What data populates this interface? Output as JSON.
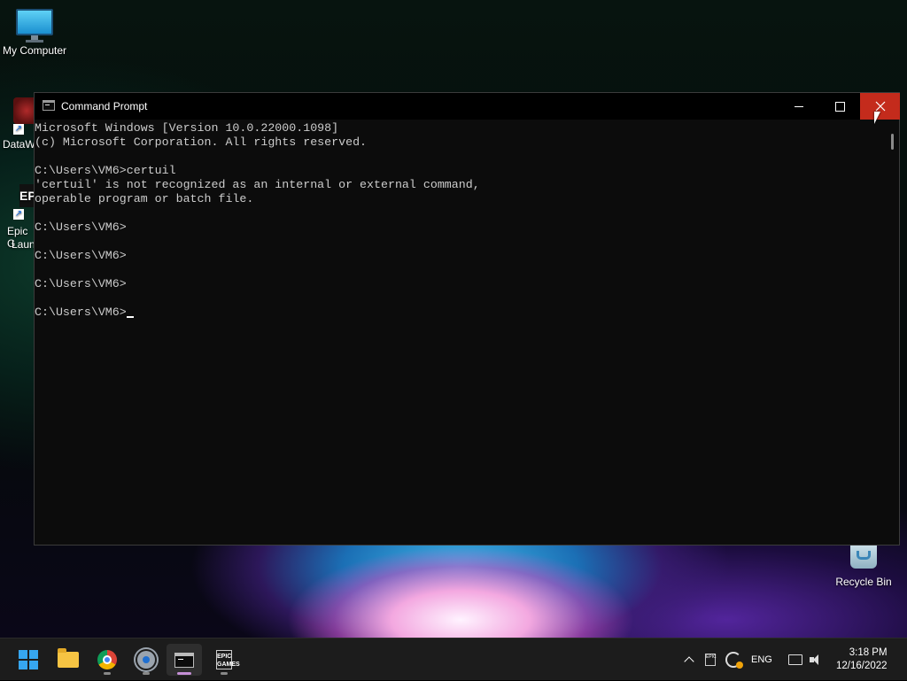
{
  "desktop": {
    "icons": {
      "my_computer": "My Computer",
      "datawrapper_partial": "DataW",
      "epic_partial_line1": "Epic G",
      "epic_partial_line2": "Laun",
      "recycle_bin": "Recycle Bin"
    }
  },
  "window": {
    "title": "Command Prompt",
    "icon": "cmd-icon",
    "controls": {
      "minimize": "minimize-icon",
      "maximize": "maximize-icon",
      "close": "close-icon"
    },
    "console_lines": [
      "Microsoft Windows [Version 10.0.22000.1098]",
      "(c) Microsoft Corporation. All rights reserved.",
      "",
      "C:\\Users\\VM6>certuil",
      "'certuil' is not recognized as an internal or external command,",
      "operable program or batch file.",
      "",
      "C:\\Users\\VM6>",
      "",
      "C:\\Users\\VM6>",
      "",
      "C:\\Users\\VM6>",
      "",
      "C:\\Users\\VM6>"
    ],
    "colors": {
      "background": "#0c0c0c",
      "text": "#cccccc",
      "close_hover": "#c42b1c"
    }
  },
  "taskbar": {
    "apps": [
      "start",
      "file-explorer",
      "chrome",
      "settings",
      "command-prompt",
      "epic-games-launcher"
    ],
    "active_app": "command-prompt",
    "epic_label": "EPIC\nGAMES",
    "tray": {
      "epic_tray_label": "EPIC",
      "language": "ENG",
      "time": "3:18 PM",
      "date": "12/16/2022"
    }
  }
}
